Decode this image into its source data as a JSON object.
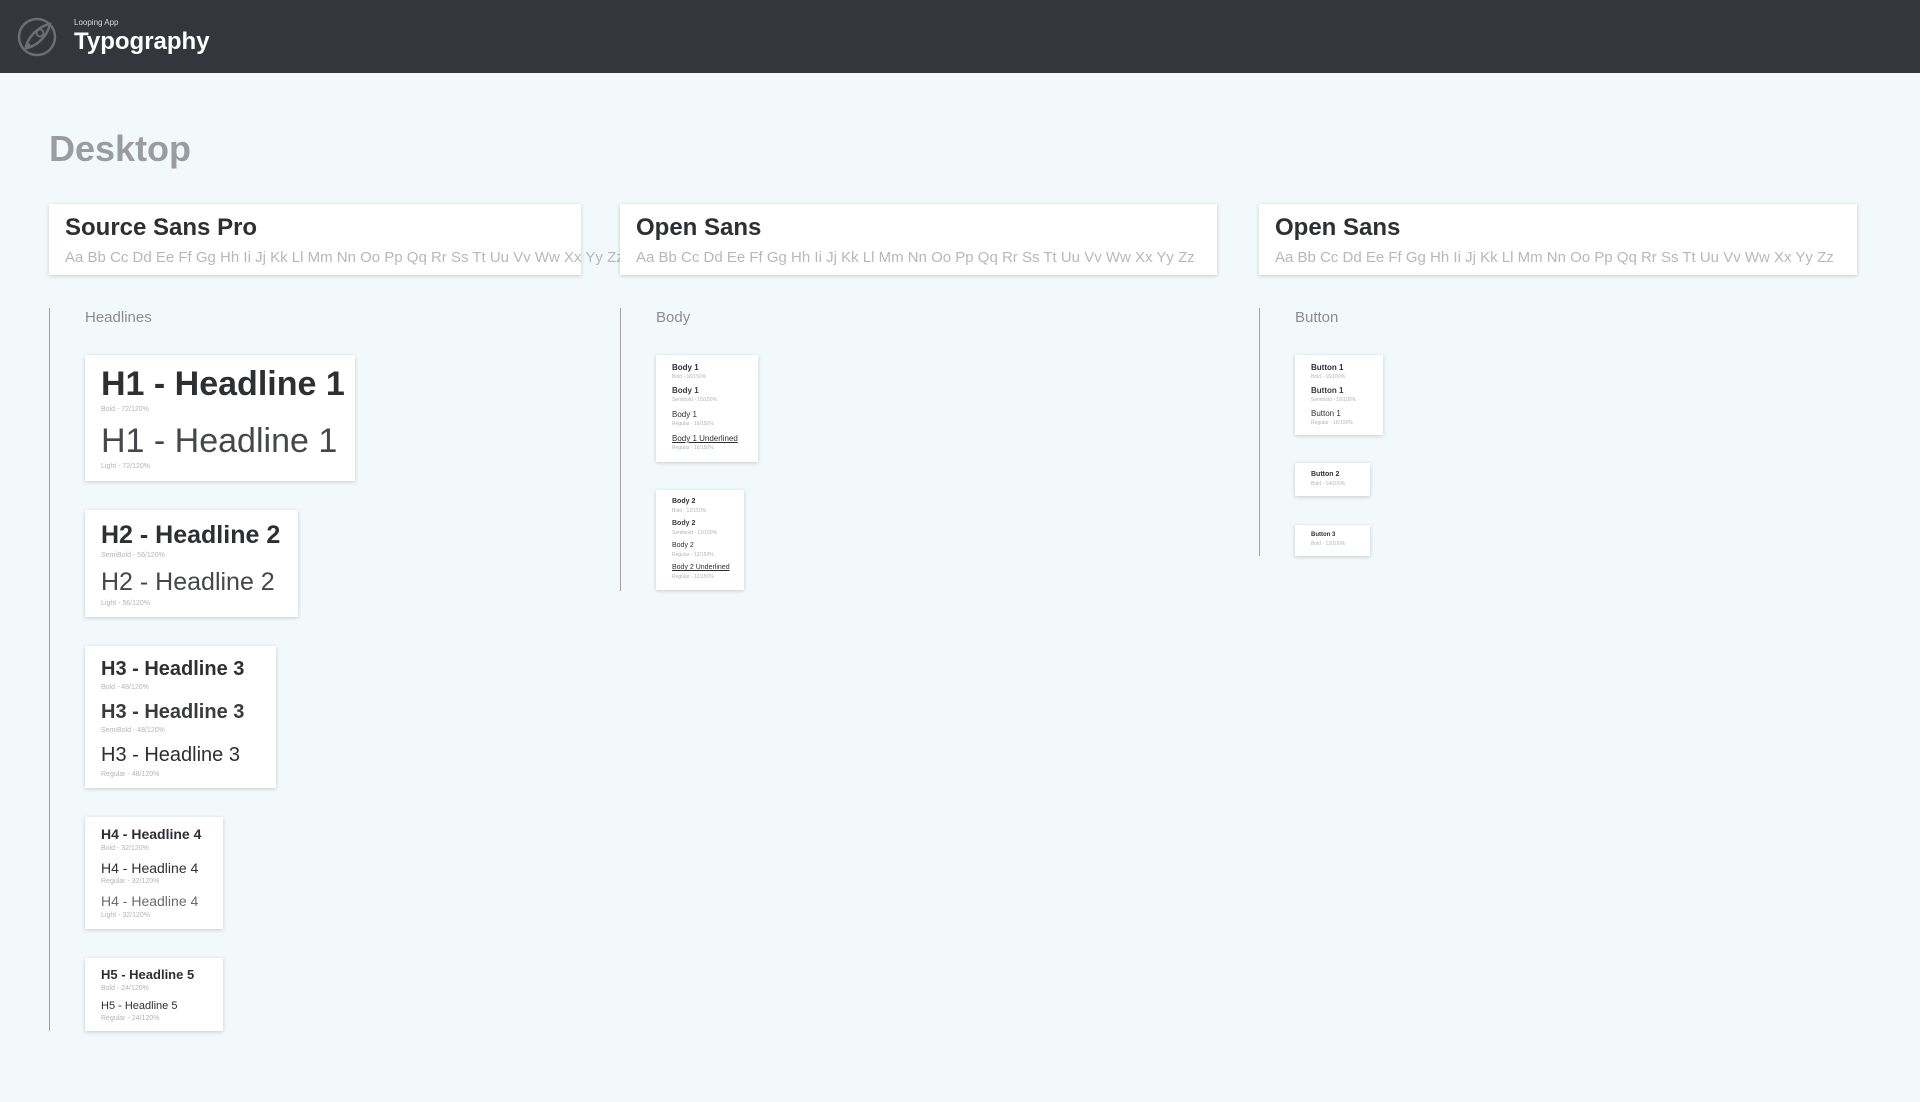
{
  "header": {
    "app_name": "Looping App",
    "title": "Typography",
    "background": "#34363b",
    "logo_icon": "rocket-logo-icon"
  },
  "section": {
    "title": "Desktop"
  },
  "fonts": [
    {
      "name": "Source Sans Pro",
      "alphabet": "Aa Bb Cc Dd Ee Ff Gg Hh Ii Jj Kk Ll Mm Nn Oo Pp Qq Rr Ss Tt Uu Vv Ww Xx Yy Zz"
    },
    {
      "name": "Open Sans",
      "alphabet": "Aa Bb Cc Dd Ee Ff Gg Hh Ii Jj Kk Ll Mm Nn Oo Pp Qq Rr Ss Tt Uu Vv Ww Xx Yy Zz"
    },
    {
      "name": "Open Sans",
      "alphabet": "Aa Bb Cc Dd Ee Ff Gg Hh Ii Jj Kk Ll Mm Nn Oo Pp Qq Rr Ss Tt Uu Vv Ww Xx Yy Zz"
    }
  ],
  "groups": {
    "headlines": "Headlines",
    "body": "Body",
    "button": "Button"
  },
  "headlines": {
    "h1": [
      {
        "text": "H1 - Headline 1",
        "meta": "Bold - 72/120%"
      },
      {
        "text": "H1 - Headline 1",
        "meta": "Light - 72/120%"
      }
    ],
    "h2": [
      {
        "text": "H2 - Headline 2",
        "meta": "SemiBold - 56/120%"
      },
      {
        "text": "H2 - Headline 2",
        "meta": "Light - 56/120%"
      }
    ],
    "h3": [
      {
        "text": "H3 - Headline 3",
        "meta": "Bold - 48/120%"
      },
      {
        "text": "H3 - Headline 3",
        "meta": "SemiBold - 48/120%"
      },
      {
        "text": "H3 - Headline 3",
        "meta": "Regular - 48/120%"
      }
    ],
    "h4": [
      {
        "text": "H4 - Headline 4",
        "meta": "Bold - 32/120%"
      },
      {
        "text": "H4 - Headline 4",
        "meta": "Regular - 32/120%"
      },
      {
        "text": "H4 - Headline 4",
        "meta": "Light - 32/120%"
      }
    ],
    "h5": [
      {
        "text": "H5 - Headline 5",
        "meta": "Bold - 24/120%"
      },
      {
        "text": "H5 - Headline 5",
        "meta": "Regular - 24/120%"
      }
    ]
  },
  "body": {
    "body1": [
      {
        "text": "Body 1",
        "meta": "Bold - 16/150%"
      },
      {
        "text": "Body 1",
        "meta": "Semibold - 16/150%"
      },
      {
        "text": "Body 1",
        "meta": "Regular - 16/150%"
      },
      {
        "text": "Body 1 Underlined",
        "meta": "Regular - 16/150%"
      }
    ],
    "body2": [
      {
        "text": "Body 2",
        "meta": "Bold - 12/150%"
      },
      {
        "text": "Body 2",
        "meta": "Semibold - 12/150%"
      },
      {
        "text": "Body 2",
        "meta": "Regular - 12/150%"
      },
      {
        "text": "Body 2 Underlined",
        "meta": "Regular - 12/150%"
      }
    ]
  },
  "buttons": {
    "button1": [
      {
        "text": "Button 1",
        "meta": "Bold - 16/100%"
      },
      {
        "text": "Button 1",
        "meta": "Semibold - 16/100%"
      },
      {
        "text": "Button 1",
        "meta": "Regular - 16/100%"
      }
    ],
    "button2": [
      {
        "text": "Button 2",
        "meta": "Bold - 14/100%"
      }
    ],
    "button3": [
      {
        "text": "Button 3",
        "meta": "Bold - 12/100%"
      }
    ]
  }
}
